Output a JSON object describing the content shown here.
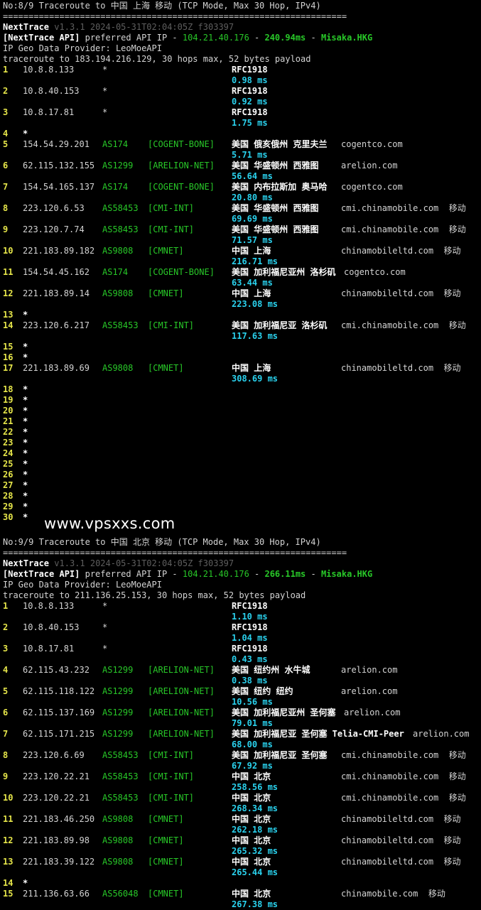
{
  "watermark": "www.vpsxxs.com",
  "sections": [
    {
      "title": "No:8/9 Traceroute to 中国 上海 移动 (TCP Mode, Max 30 Hop, IPv4)",
      "divider": "===================================================================",
      "tool": "NextTrace",
      "version": "v1.3.1 2024-05-31T02:04:05Z f303397",
      "api_tag": "[NextTrace API]",
      "api_text": "preferred API IP -",
      "api_ip": "104.21.40.176",
      "api_sep": "-",
      "api_ms": "240.94ms",
      "api_sep2": "-",
      "api_node": "Misaka.HKG",
      "geo": "IP Geo Data Provider: LeoMoeAPI",
      "trace": "traceroute to 183.194.216.129, 30 hops max, 52 bytes payload",
      "hops": [
        {
          "n": "1",
          "ip": "10.8.8.133",
          "asn": "*",
          "tag": "",
          "geo": "RFC1918",
          "dom": "",
          "ms": "0.98 ms"
        },
        {
          "n": "2",
          "ip": "10.8.40.153",
          "asn": "*",
          "tag": "",
          "geo": "RFC1918",
          "dom": "",
          "ms": "0.92 ms"
        },
        {
          "n": "3",
          "ip": "10.8.17.81",
          "asn": "*",
          "tag": "",
          "geo": "RFC1918",
          "dom": "",
          "ms": "1.75 ms"
        },
        {
          "n": "4",
          "ip": "*"
        },
        {
          "n": "5",
          "ip": "154.54.29.201",
          "asn": "AS174",
          "tag": "[COGENT-BONE]",
          "geo": "美国 俄亥俄州 克里夫兰",
          "dom": "cogentco.com",
          "ms": "5.71 ms"
        },
        {
          "n": "6",
          "ip": "62.115.132.155",
          "asn": "AS1299",
          "tag": "[ARELION-NET]",
          "geo": "美国 华盛顿州 西雅图",
          "dom": "arelion.com",
          "ms": "56.64 ms"
        },
        {
          "n": "7",
          "ip": "154.54.165.137",
          "asn": "AS174",
          "tag": "[COGENT-BONE]",
          "geo": "美国 内布拉斯加 奥马哈",
          "dom": "cogentco.com",
          "ms": "20.80 ms"
        },
        {
          "n": "8",
          "ip": "223.120.6.53",
          "asn": "AS58453",
          "tag": "[CMI-INT]",
          "geo": "美国 华盛顿州 西雅图",
          "dom": "cmi.chinamobile.com  移动",
          "ms": "69.69 ms"
        },
        {
          "n": "9",
          "ip": "223.120.7.74",
          "asn": "AS58453",
          "tag": "[CMI-INT]",
          "geo": "美国 华盛顿州 西雅图",
          "dom": "cmi.chinamobile.com  移动",
          "ms": "71.57 ms"
        },
        {
          "n": "10",
          "ip": "221.183.89.182",
          "asn": "AS9808",
          "tag": "[CMNET]",
          "geo": "中国 上海",
          "dom": "chinamobileltd.com  移动",
          "ms": "216.71 ms"
        },
        {
          "n": "11",
          "ip": "154.54.45.162",
          "asn": "AS174",
          "tag": "[COGENT-BONE]",
          "geo": "美国 加利福尼亚州 洛杉矶",
          "dom": "cogentco.com",
          "ms": "63.44 ms"
        },
        {
          "n": "12",
          "ip": "221.183.89.14",
          "asn": "AS9808",
          "tag": "[CMNET]",
          "geo": "中国 上海",
          "dom": "chinamobileltd.com  移动",
          "ms": "223.08 ms"
        },
        {
          "n": "13",
          "ip": "*"
        },
        {
          "n": "14",
          "ip": "223.120.6.217",
          "asn": "AS58453",
          "tag": "[CMI-INT]",
          "geo": "美国 加利福尼亚 洛杉矶",
          "dom": "cmi.chinamobile.com  移动",
          "ms": "117.63 ms"
        },
        {
          "n": "15",
          "ip": "*"
        },
        {
          "n": "16",
          "ip": "*"
        },
        {
          "n": "17",
          "ip": "221.183.89.69",
          "asn": "AS9808",
          "tag": "[CMNET]",
          "geo": "中国 上海",
          "dom": "chinamobileltd.com  移动",
          "ms": "308.69 ms"
        },
        {
          "n": "18",
          "ip": "*"
        },
        {
          "n": "19",
          "ip": "*"
        },
        {
          "n": "20",
          "ip": "*"
        },
        {
          "n": "21",
          "ip": "*"
        },
        {
          "n": "22",
          "ip": "*"
        },
        {
          "n": "23",
          "ip": "*"
        },
        {
          "n": "24",
          "ip": "*"
        },
        {
          "n": "25",
          "ip": "*"
        },
        {
          "n": "26",
          "ip": "*"
        },
        {
          "n": "27",
          "ip": "*"
        },
        {
          "n": "28",
          "ip": "*"
        },
        {
          "n": "29",
          "ip": "*"
        },
        {
          "n": "30",
          "ip": "*"
        }
      ]
    },
    {
      "title": "No:9/9 Traceroute to 中国 北京 移动 (TCP Mode, Max 30 Hop, IPv4)",
      "divider": "===================================================================",
      "tool": "NextTrace",
      "version": "v1.3.1 2024-05-31T02:04:05Z f303397",
      "api_tag": "[NextTrace API]",
      "api_text": "preferred API IP -",
      "api_ip": "104.21.40.176",
      "api_sep": "-",
      "api_ms": "266.11ms",
      "api_sep2": "-",
      "api_node": "Misaka.HKG",
      "geo": "IP Geo Data Provider: LeoMoeAPI",
      "trace": "traceroute to 211.136.25.153, 30 hops max, 52 bytes payload",
      "hops": [
        {
          "n": "1",
          "ip": "10.8.8.133",
          "asn": "*",
          "tag": "",
          "geo": "RFC1918",
          "dom": "",
          "ms": "1.10 ms"
        },
        {
          "n": "2",
          "ip": "10.8.40.153",
          "asn": "*",
          "tag": "",
          "geo": "RFC1918",
          "dom": "",
          "ms": "1.04 ms"
        },
        {
          "n": "3",
          "ip": "10.8.17.81",
          "asn": "*",
          "tag": "",
          "geo": "RFC1918",
          "dom": "",
          "ms": "0.43 ms"
        },
        {
          "n": "4",
          "ip": "62.115.43.232",
          "asn": "AS1299",
          "tag": "[ARELION-NET]",
          "geo": "美国 纽约州 水牛城",
          "dom": "arelion.com",
          "ms": "0.38 ms"
        },
        {
          "n": "5",
          "ip": "62.115.118.122",
          "asn": "AS1299",
          "tag": "[ARELION-NET]",
          "geo": "美国 纽约 纽约",
          "dom": "arelion.com",
          "ms": "10.56 ms"
        },
        {
          "n": "6",
          "ip": "62.115.137.169",
          "asn": "AS1299",
          "tag": "[ARELION-NET]",
          "geo": "美国 加利福尼亚州 圣何塞",
          "dom": "arelion.com",
          "ms": "79.01 ms"
        },
        {
          "n": "7",
          "ip": "62.115.171.215",
          "asn": "AS1299",
          "tag": "[ARELION-NET]",
          "geo": "美国 加利福尼亚 圣何塞 Telia-CMI-Peer",
          "dom": "arelion.com",
          "ms": "68.00 ms"
        },
        {
          "n": "8",
          "ip": "223.120.6.69",
          "asn": "AS58453",
          "tag": "[CMI-INT]",
          "geo": "美国 加利福尼亚 圣何塞",
          "dom": "cmi.chinamobile.com  移动",
          "ms": "67.92 ms"
        },
        {
          "n": "9",
          "ip": "223.120.22.21",
          "asn": "AS58453",
          "tag": "[CMI-INT]",
          "geo": "中国 北京",
          "dom": "cmi.chinamobile.com  移动",
          "ms": "258.56 ms"
        },
        {
          "n": "10",
          "ip": "223.120.22.21",
          "asn": "AS58453",
          "tag": "[CMI-INT]",
          "geo": "中国 北京",
          "dom": "cmi.chinamobile.com  移动",
          "ms": "268.34 ms"
        },
        {
          "n": "11",
          "ip": "221.183.46.250",
          "asn": "AS9808",
          "tag": "[CMNET]",
          "geo": "中国 北京",
          "dom": "chinamobileltd.com  移动",
          "ms": "262.18 ms"
        },
        {
          "n": "12",
          "ip": "221.183.89.98",
          "asn": "AS9808",
          "tag": "[CMNET]",
          "geo": "中国 北京",
          "dom": "chinamobileltd.com  移动",
          "ms": "265.32 ms"
        },
        {
          "n": "13",
          "ip": "221.183.39.122",
          "asn": "AS9808",
          "tag": "[CMNET]",
          "geo": "中国 北京",
          "dom": "chinamobileltd.com  移动",
          "ms": "265.44 ms"
        },
        {
          "n": "14",
          "ip": "*"
        },
        {
          "n": "15",
          "ip": "211.136.63.66",
          "asn": "AS56048",
          "tag": "[CMNET]",
          "geo": "中国 北京",
          "dom": "chinamobile.com  移动",
          "ms": "267.38 ms"
        }
      ]
    }
  ]
}
